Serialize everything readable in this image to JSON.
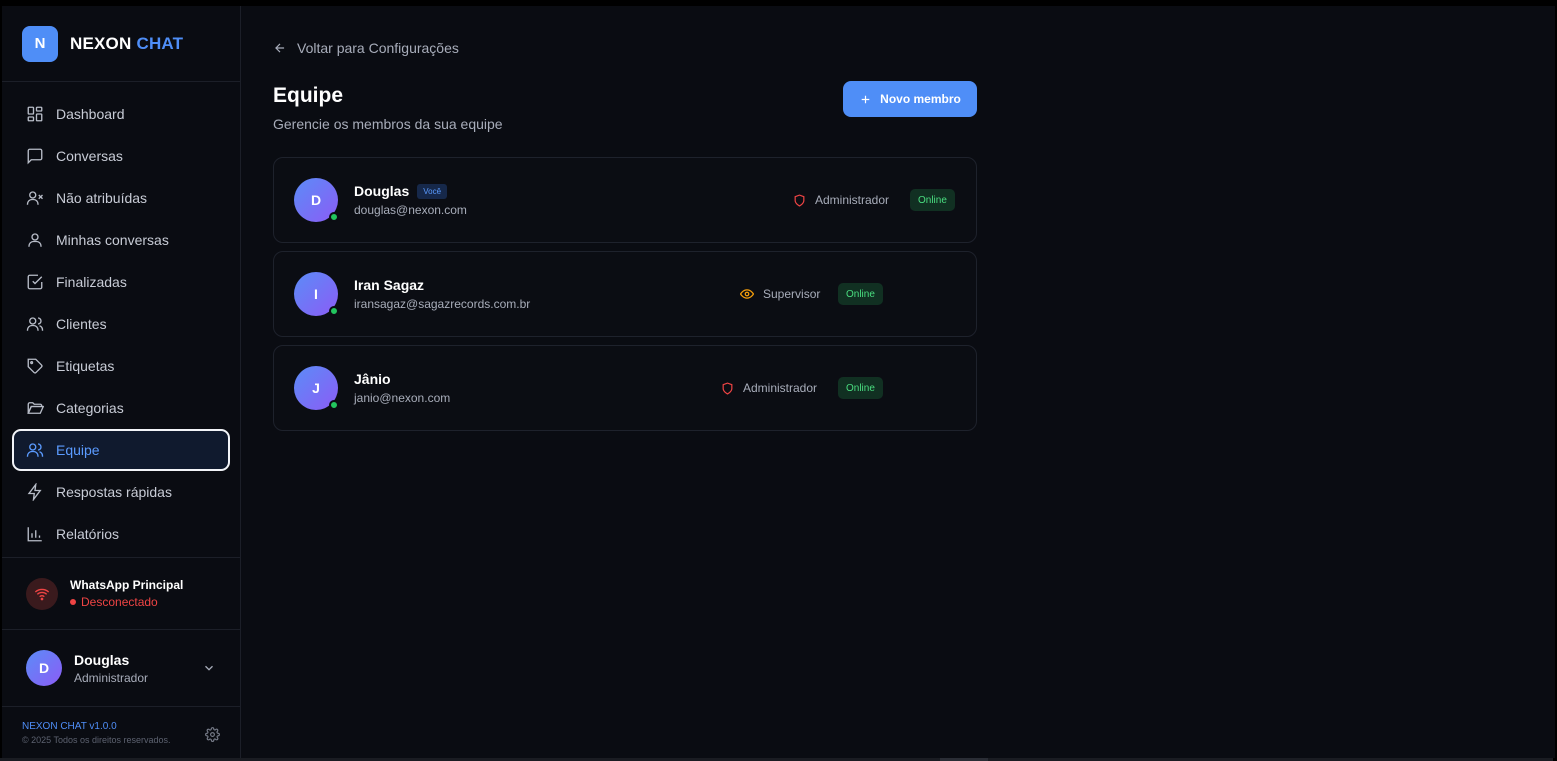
{
  "brand": {
    "logo_letter": "N",
    "name_1": "NEXON",
    "name_2": "CHAT"
  },
  "sidebar": {
    "items": [
      {
        "label": "Dashboard",
        "icon": "dashboard-icon"
      },
      {
        "label": "Conversas",
        "icon": "message-icon"
      },
      {
        "label": "Não atribuídas",
        "icon": "user-x-icon"
      },
      {
        "label": "Minhas conversas",
        "icon": "user-icon"
      },
      {
        "label": "Finalizadas",
        "icon": "check-square-icon"
      },
      {
        "label": "Clientes",
        "icon": "users-icon"
      },
      {
        "label": "Etiquetas",
        "icon": "tag-icon"
      },
      {
        "label": "Categorias",
        "icon": "folder-icon"
      },
      {
        "label": "Equipe",
        "icon": "team-icon",
        "active": true
      },
      {
        "label": "Respostas rápidas",
        "icon": "zap-icon"
      },
      {
        "label": "Relatórios",
        "icon": "bar-chart-icon"
      }
    ]
  },
  "whatsapp": {
    "title": "WhatsApp Principal",
    "status": "Desconectado"
  },
  "current_user": {
    "initial": "D",
    "name": "Douglas",
    "role": "Administrador"
  },
  "footer": {
    "version": "NEXON CHAT v1.0.0",
    "copyright": "© 2025 Todos os direitos reservados."
  },
  "main": {
    "back_label": "Voltar para Configurações",
    "title": "Equipe",
    "subtitle": "Gerencie os membros da sua equipe",
    "new_member_label": "Novo membro"
  },
  "members": [
    {
      "initial": "D",
      "name": "Douglas",
      "you_badge": "Você",
      "email": "douglas@nexon.com",
      "role": "Administrador",
      "role_icon": "shield-icon",
      "status": "Online"
    },
    {
      "initial": "I",
      "name": "Iran Sagaz",
      "email": "iransagaz@sagazrecords.com.br",
      "role": "Supervisor",
      "role_icon": "eye-icon",
      "status": "Online"
    },
    {
      "initial": "J",
      "name": "Jânio",
      "email": "janio@nexon.com",
      "role": "Administrador",
      "role_icon": "shield-icon",
      "status": "Online"
    }
  ],
  "colors": {
    "accent": "#4f8ef7",
    "online": "#4ade80",
    "danger": "#ef4444",
    "supervisor": "#f59e0b"
  }
}
